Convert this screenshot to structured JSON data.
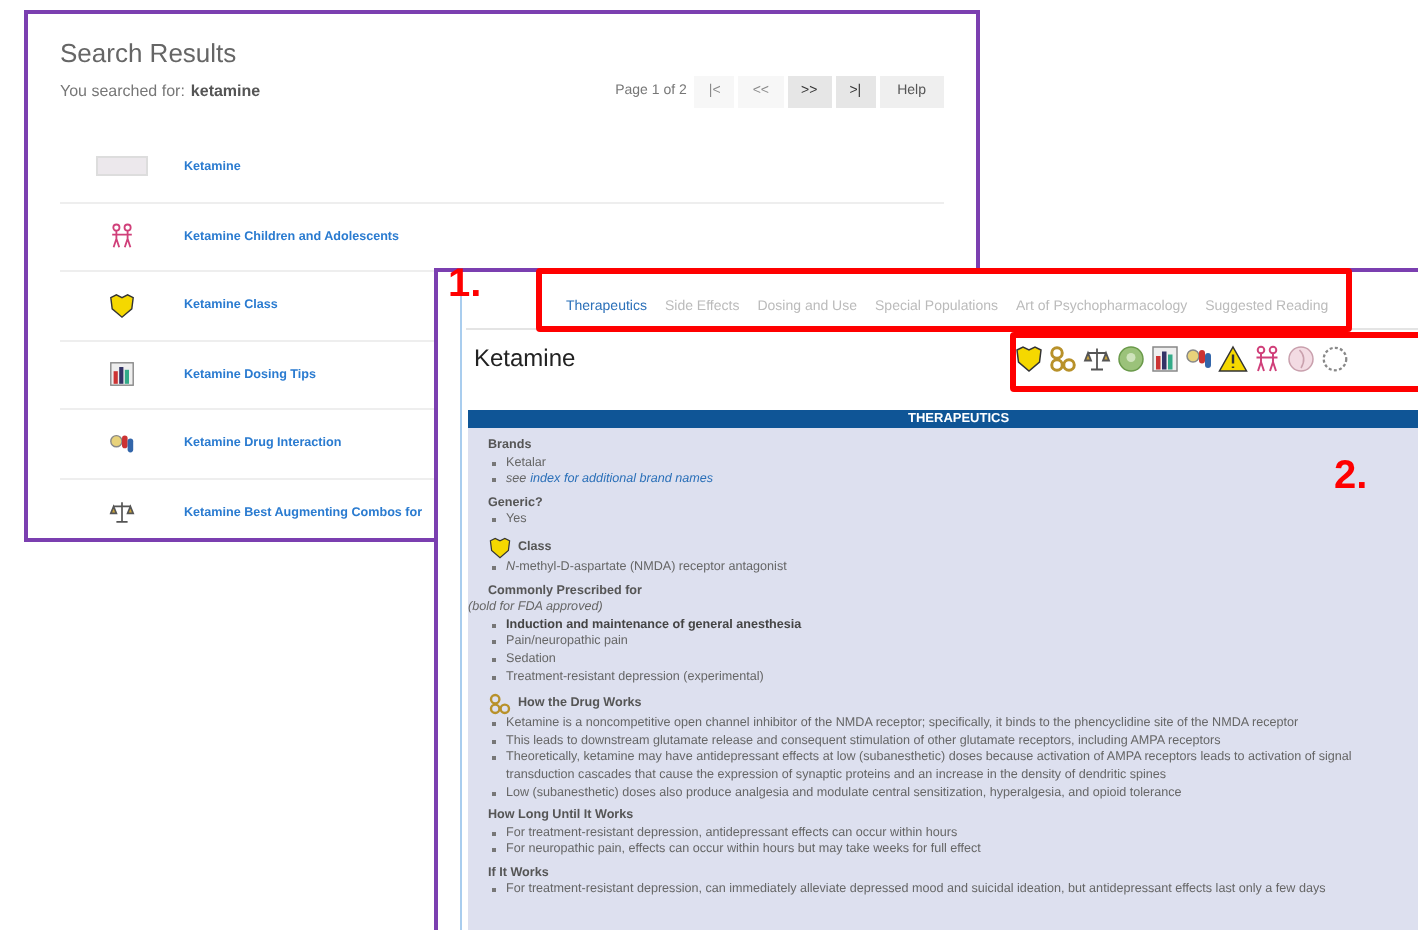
{
  "search_results": {
    "title": "Search Results",
    "searched_label": "You searched for:",
    "query": "ketamine",
    "page_info": "Page 1 of 2",
    "pager": [
      {
        "label": "|<",
        "disabled": true
      },
      {
        "label": "<<",
        "disabled": true
      },
      {
        "label": ">>",
        "disabled": false
      },
      {
        "label": ">|",
        "disabled": false
      }
    ],
    "help": "Help",
    "results": [
      {
        "kind": "placeholder",
        "title": "Ketamine"
      },
      {
        "kind": "children",
        "title": "Ketamine Children and Adolescents"
      },
      {
        "kind": "class",
        "title": "Ketamine Class"
      },
      {
        "kind": "dosing",
        "title": "Ketamine Dosing Tips"
      },
      {
        "kind": "interaction",
        "title": "Ketamine Drug Interaction"
      },
      {
        "kind": "scale",
        "title": "Ketamine Best Augmenting Combos for"
      }
    ]
  },
  "monograph": {
    "tabs": [
      {
        "label": "Therapeutics",
        "selected": true
      },
      {
        "label": "Side Effects",
        "selected": false
      },
      {
        "label": "Dosing and Use",
        "selected": false
      },
      {
        "label": "Special Populations",
        "selected": false
      },
      {
        "label": "Art of Psychopharmacology",
        "selected": false
      },
      {
        "label": "Suggested Reading",
        "selected": false
      }
    ],
    "title": "Ketamine",
    "section_header": "THERAPEUTICS",
    "sections": [
      {
        "kind": "plain",
        "heading": "Brands",
        "items": [
          {
            "text": "Ketalar"
          },
          {
            "text": "see",
            "link": "index for additional brand names",
            "italic": true
          }
        ]
      },
      {
        "kind": "plain",
        "heading": "Generic?",
        "items": [
          {
            "text": "Yes"
          }
        ]
      },
      {
        "kind": "class",
        "heading": "Class",
        "items": [
          {
            "text": "*N*-methyl-D-aspartate (NMDA) receptor antagonist"
          }
        ]
      },
      {
        "kind": "plain",
        "heading": "Commonly Prescribed for",
        "note": "(bold for FDA approved)",
        "items": [
          {
            "text": "Induction and maintenance of general anesthesia",
            "bold": true
          },
          {
            "text": "Pain/neuropathic pain"
          },
          {
            "text": "Sedation"
          },
          {
            "text": "Treatment-resistant depression (experimental)"
          }
        ]
      },
      {
        "kind": "gears",
        "heading": "How the Drug Works",
        "items": [
          {
            "text": "Ketamine is a noncompetitive open channel inhibitor of the NMDA receptor; specifically, it binds to the phencyclidine site of the NMDA receptor"
          },
          {
            "text": "This leads to downstream glutamate release and consequent stimulation of other glutamate receptors, including AMPA receptors"
          },
          {
            "text": "Theoretically, ketamine may have antidepressant effects at low (subanesthetic) doses because activation of AMPA receptors leads to activation of signal transduction cascades that cause the expression of synaptic proteins and an increase in the density of dendritic spines"
          },
          {
            "text": "Low (subanesthetic) doses also produce analgesia and modulate central sensitization, hyperalgesia, and opioid tolerance"
          }
        ]
      },
      {
        "kind": "plain",
        "heading": "How Long Until It Works",
        "items": [
          {
            "text": "For treatment-resistant depression, antidepressant effects can occur within hours"
          },
          {
            "text": "For neuropathic pain, effects can occur within hours but may take weeks for full effect"
          }
        ]
      },
      {
        "kind": "plain",
        "heading": "If It Works",
        "items": [
          {
            "text": "For treatment-resistant depression, can immediately alleviate depressed mood and suicidal ideation, but antidepressant effects last only a few days"
          }
        ]
      }
    ]
  },
  "annotations": [
    {
      "label": "1."
    },
    {
      "label": "2."
    }
  ]
}
